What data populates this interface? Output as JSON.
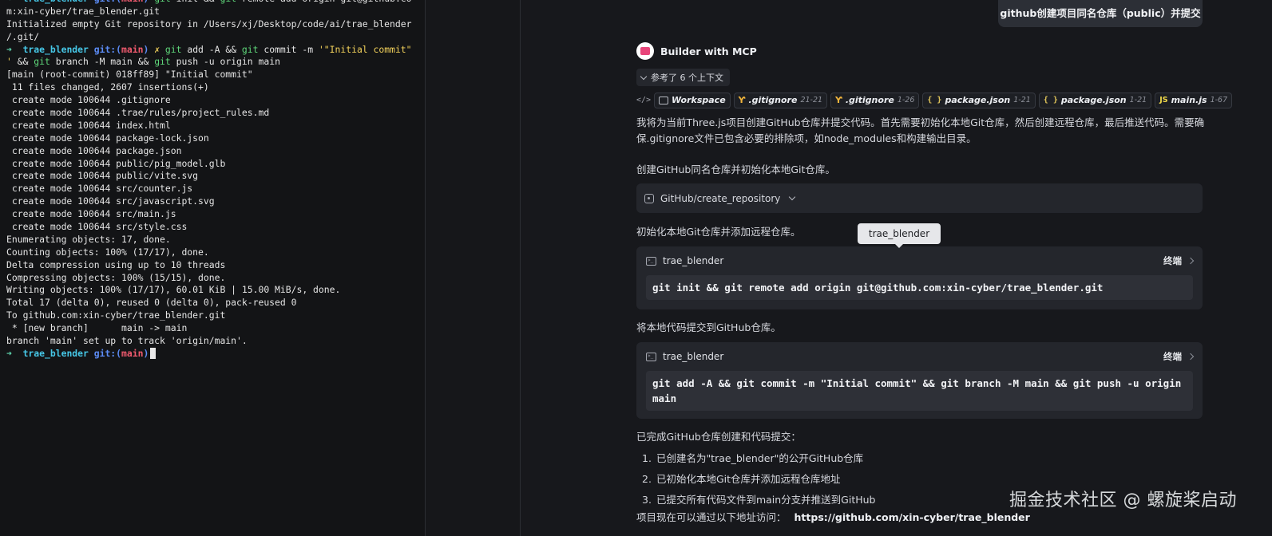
{
  "terminal": {
    "lines": [
      [
        {
          "t": "➜  ",
          "c": "c-arrow"
        },
        {
          "t": "trae_blender ",
          "c": "c-dir"
        },
        {
          "t": "git:(",
          "c": "c-git"
        },
        {
          "t": "main",
          "c": "c-branch"
        },
        {
          "t": ") ",
          "c": "c-git"
        },
        {
          "t": "git",
          "c": "c-cmd"
        },
        {
          "t": " init && "
        },
        {
          "t": "git",
          "c": "c-cmd"
        },
        {
          "t": " remote add origin git@github.co"
        }
      ],
      [
        {
          "t": "m:xin-cyber/trae_blender.git"
        }
      ],
      [
        {
          "t": "Initialized empty Git repository in /Users/xj/Desktop/code/ai/trae_blender"
        }
      ],
      [
        {
          "t": "/.git/"
        }
      ],
      [
        {
          "t": "➜  ",
          "c": "c-arrow"
        },
        {
          "t": "trae_blender ",
          "c": "c-dir"
        },
        {
          "t": "git:(",
          "c": "c-git"
        },
        {
          "t": "main",
          "c": "c-branch"
        },
        {
          "t": ") ",
          "c": "c-git"
        },
        {
          "t": "✗ ",
          "c": "c-dirty"
        },
        {
          "t": "git",
          "c": "c-cmd"
        },
        {
          "t": " add -A && "
        },
        {
          "t": "git",
          "c": "c-cmd"
        },
        {
          "t": " commit -m "
        },
        {
          "t": "'\"Initial commit\"",
          "c": "c-str"
        }
      ],
      [
        {
          "t": "'",
          "c": "c-str"
        },
        {
          "t": " && "
        },
        {
          "t": "git",
          "c": "c-cmd"
        },
        {
          "t": " branch -M main && "
        },
        {
          "t": "git",
          "c": "c-cmd"
        },
        {
          "t": " push -u origin main"
        }
      ],
      [
        {
          "t": "[main (root-commit) 018ff89] \"Initial commit\""
        }
      ],
      [
        {
          "t": " 11 files changed, 2607 insertions(+)"
        }
      ],
      [
        {
          "t": " create mode 100644 .gitignore"
        }
      ],
      [
        {
          "t": " create mode 100644 .trae/rules/project_rules.md"
        }
      ],
      [
        {
          "t": " create mode 100644 index.html"
        }
      ],
      [
        {
          "t": " create mode 100644 package-lock.json"
        }
      ],
      [
        {
          "t": " create mode 100644 package.json"
        }
      ],
      [
        {
          "t": " create mode 100644 public/pig_model.glb"
        }
      ],
      [
        {
          "t": " create mode 100644 public/vite.svg"
        }
      ],
      [
        {
          "t": " create mode 100644 src/counter.js"
        }
      ],
      [
        {
          "t": " create mode 100644 src/javascript.svg"
        }
      ],
      [
        {
          "t": " create mode 100644 src/main.js"
        }
      ],
      [
        {
          "t": " create mode 100644 src/style.css"
        }
      ],
      [
        {
          "t": "Enumerating objects: 17, done."
        }
      ],
      [
        {
          "t": "Counting objects: 100% (17/17), done."
        }
      ],
      [
        {
          "t": "Delta compression using up to 10 threads"
        }
      ],
      [
        {
          "t": "Compressing objects: 100% (15/15), done."
        }
      ],
      [
        {
          "t": "Writing objects: 100% (17/17), 60.01 KiB | 15.00 MiB/s, done."
        }
      ],
      [
        {
          "t": "Total 17 (delta 0), reused 0 (delta 0), pack-reused 0"
        }
      ],
      [
        {
          "t": "To github.com:xin-cyber/trae_blender.git"
        }
      ],
      [
        {
          "t": " * [new branch]      main -> main"
        }
      ],
      [
        {
          "t": "branch 'main' set up to track 'origin/main'."
        }
      ],
      [
        {
          "t": "➜  ",
          "c": "c-arrow"
        },
        {
          "t": "trae_blender ",
          "c": "c-dir"
        },
        {
          "t": "git:(",
          "c": "c-git"
        },
        {
          "t": "main",
          "c": "c-branch"
        },
        {
          "t": ")",
          "c": "c-git"
        },
        {
          "t": " ",
          "cursor": true
        }
      ]
    ]
  },
  "chat": {
    "user_message": "github创建项目同名仓库（public）并提交",
    "agent_name": "Builder with MCP",
    "context_toggle": "参考了 6 个上下文",
    "refs": [
      {
        "icon": "folder",
        "label": "Workspace",
        "range": ""
      },
      {
        "icon": "branch",
        "label": ".gitignore",
        "range": "21-21"
      },
      {
        "icon": "branch",
        "label": ".gitignore",
        "range": "1-26"
      },
      {
        "icon": "braces",
        "label": "package.json",
        "range": "1-21"
      },
      {
        "icon": "braces",
        "label": "package.json",
        "range": "1-21"
      },
      {
        "icon": "js",
        "label": "main.js",
        "range": "1-67"
      }
    ],
    "intro": "我将为当前Three.js项目创建GitHub仓库并提交代码。首先需要初始化本地Git仓库，然后创建远程仓库，最后推送代码。需要确保.gitignore文件已包含必要的排除项，如node_modules和构建输出目录。",
    "step1_text": "创建GitHub同名仓库并初始化本地Git仓库。",
    "tool_call": "GitHub/create_repository",
    "step2_text": "初始化本地Git仓库并添加远程仓库。",
    "tooltip": "trae_blender",
    "cmd1": {
      "title": "trae_blender",
      "link": "终端",
      "command": "git init && git remote add origin git@github.com:xin-cyber/trae_blender.git"
    },
    "step3_text": "将本地代码提交到GitHub仓库。",
    "cmd2": {
      "title": "trae_blender",
      "link": "终端",
      "command": "git add -A && git commit -m \"Initial commit\" && git branch -M main && git push -u origin main"
    },
    "summary": "已完成GitHub仓库创建和代码提交：",
    "steps": [
      {
        "n": "1.",
        "text": "已创建名为\"trae_blender\"的公开GitHub仓库"
      },
      {
        "n": "2.",
        "text": "已初始化本地Git仓库并添加远程仓库地址"
      },
      {
        "n": "3.",
        "text": "已提交所有代码文件到main分支并推送到GitHub"
      }
    ],
    "footer_text": "项目现在可以通过以下地址访问：",
    "footer_url": "https://github.com/xin-cyber/trae_blender"
  },
  "watermark": "掘金技术社区 @ 螺旋桨启动"
}
